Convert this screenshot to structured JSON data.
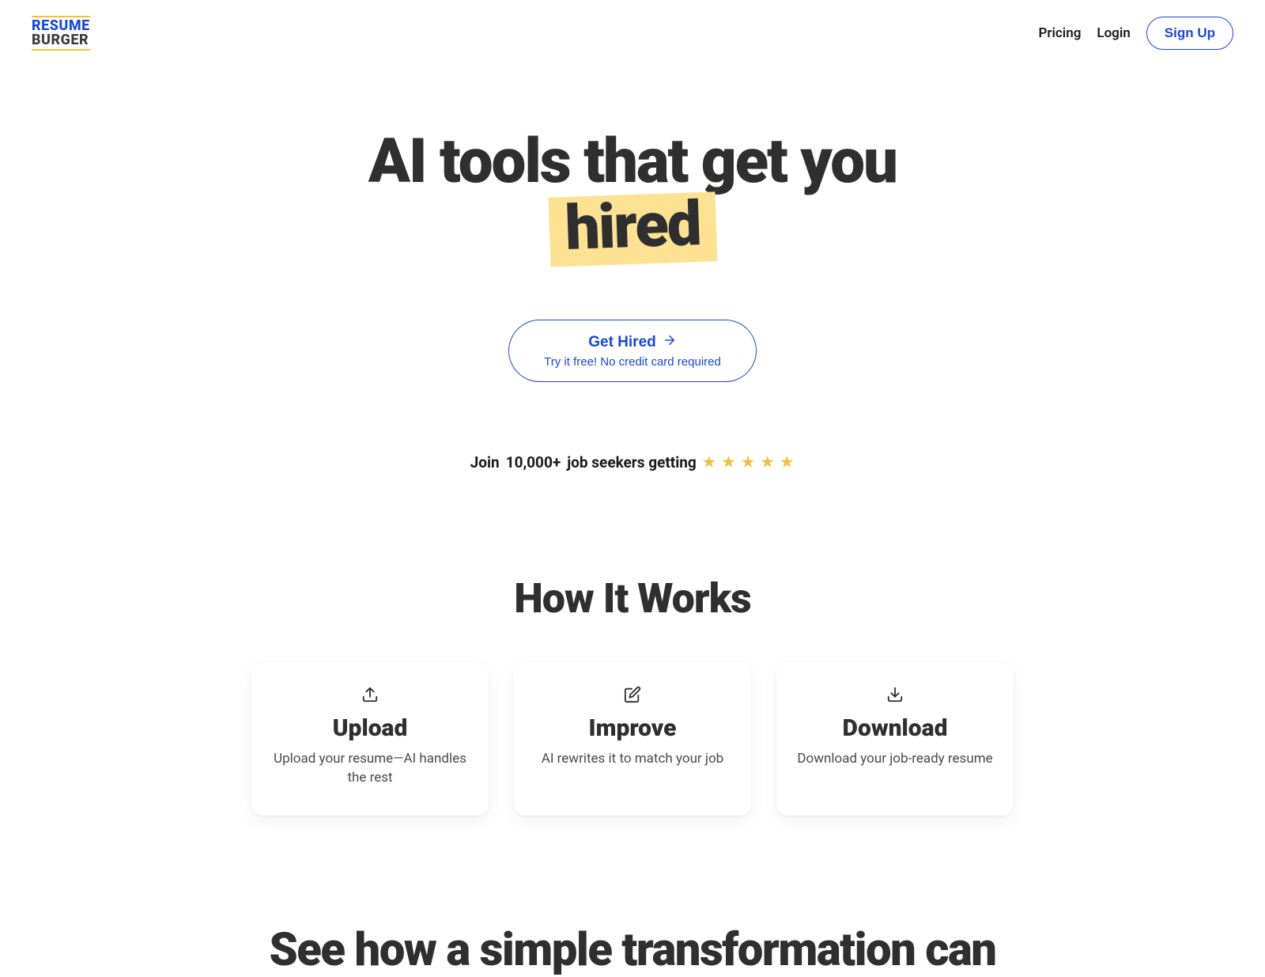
{
  "logo": {
    "top": "RESUME",
    "bottom": "BURGER"
  },
  "nav": {
    "pricing": "Pricing",
    "login": "Login",
    "signup": "Sign Up"
  },
  "hero": {
    "line1": "AI tools that get you",
    "highlight": "hired",
    "cta_main": "Get Hired",
    "cta_sub": "Try it free! No credit card required"
  },
  "social_proof": {
    "join": "Join",
    "count": "10,000+",
    "tail": "job seekers getting"
  },
  "how_it_works": {
    "heading": "How It Works",
    "cards": [
      {
        "title": "Upload",
        "desc": "Upload your resume—AI handles the rest"
      },
      {
        "title": "Improve",
        "desc": "AI rewrites it to match your job"
      },
      {
        "title": "Download",
        "desc": "Download your job-ready resume"
      }
    ]
  },
  "transform": {
    "heading": "See how a simple transformation can"
  }
}
